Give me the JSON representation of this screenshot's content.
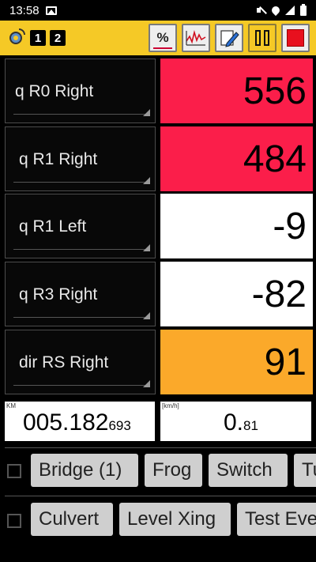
{
  "status_bar": {
    "time": "13:58"
  },
  "toolbar": {
    "channel_1": "1",
    "channel_2": "2",
    "percent_label": "%"
  },
  "rows": [
    {
      "label": "q R0 Right",
      "value": "556",
      "color": "#fb1e4a"
    },
    {
      "label": "q R1 Right",
      "value": "484",
      "color": "#fb1e4a"
    },
    {
      "label": "q R1 Left",
      "value": "-9",
      "color": "#ffffff"
    },
    {
      "label": "q R3 Right",
      "value": "-82",
      "color": "#ffffff"
    },
    {
      "label": "dir RS Right",
      "value": "91",
      "color": "#fba92a"
    }
  ],
  "position": {
    "unit": "KM",
    "main": "005.182",
    "fraction": "693"
  },
  "speed": {
    "unit": "[km/h]",
    "main": "0.",
    "fraction": "81"
  },
  "event_rows": [
    {
      "buttons": [
        "Bridge (1)",
        "Frog",
        "Switch",
        "Tu"
      ]
    },
    {
      "buttons": [
        "Culvert",
        "Level Xing",
        "Test Eve"
      ]
    }
  ]
}
